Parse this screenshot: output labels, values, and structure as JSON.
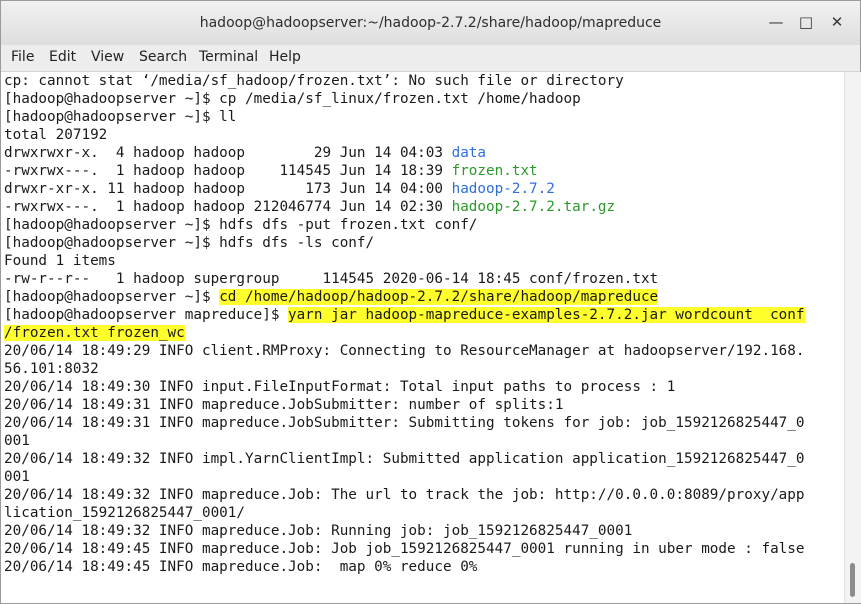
{
  "window": {
    "title": "hadoop@hadoopserver:~/hadoop-2.7.2/share/hadoop/mapreduce",
    "min_icon": "minimize-icon",
    "max_icon": "maximize-icon",
    "close_icon": "close-icon",
    "min_glyph": "—",
    "max_glyph": "□",
    "close_glyph": "✕"
  },
  "menu": [
    "File",
    "Edit",
    "View",
    "Search",
    "Terminal",
    "Help"
  ],
  "colors": {
    "highlight": "#ffff2b",
    "directory": "#2f6fd9",
    "executable": "#2a9a2a"
  },
  "lines": [
    [
      {
        "t": "cp: cannot stat ‘/media/sf_hadoop/frozen.txt’: No such file or directory"
      }
    ],
    [
      {
        "t": "[hadoop@hadoopserver ~]$ cp /media/sf_linux/frozen.txt /home/hadoop"
      }
    ],
    [
      {
        "t": "[hadoop@hadoopserver ~]$ ll"
      }
    ],
    [
      {
        "t": "total 207192"
      }
    ],
    [
      {
        "t": "drwxrwxr-x.  4 hadoop hadoop        29 Jun 14 04:03 "
      },
      {
        "t": "data",
        "c": "blue"
      }
    ],
    [
      {
        "t": "-rwxrwx---.  1 hadoop hadoop    114545 Jun 14 18:39 "
      },
      {
        "t": "frozen.txt",
        "c": "green"
      }
    ],
    [
      {
        "t": "drwxr-xr-x. 11 hadoop hadoop       173 Jun 14 04:00 "
      },
      {
        "t": "hadoop-2.7.2",
        "c": "blue"
      }
    ],
    [
      {
        "t": "-rwxrwx---.  1 hadoop hadoop 212046774 Jun 14 02:30 "
      },
      {
        "t": "hadoop-2.7.2.tar.gz",
        "c": "green"
      }
    ],
    [
      {
        "t": "[hadoop@hadoopserver ~]$ hdfs dfs -put frozen.txt conf/"
      }
    ],
    [
      {
        "t": "[hadoop@hadoopserver ~]$ hdfs dfs -ls conf/"
      }
    ],
    [
      {
        "t": "Found 1 items"
      }
    ],
    [
      {
        "t": "-rw-r--r--   1 hadoop supergroup     114545 2020-06-14 18:45 conf/frozen.txt"
      }
    ],
    [
      {
        "t": "[hadoop@hadoopserver ~]$ "
      },
      {
        "t": "cd /home/hadoop/hadoop-2.7.2/share/hadoop/mapreduce",
        "c": "hl"
      }
    ],
    [
      {
        "t": "[hadoop@hadoopserver mapreduce]$ "
      },
      {
        "t": "yarn jar hadoop-mapreduce-examples-2.7.2.jar wordcount  conf",
        "c": "hl"
      }
    ],
    [
      {
        "t": "/frozen.txt frozen_wc",
        "c": "hl"
      }
    ],
    [
      {
        "t": "20/06/14 18:49:29 INFO client.RMProxy: Connecting to ResourceManager at hadoopserver/192.168."
      }
    ],
    [
      {
        "t": "56.101:8032"
      }
    ],
    [
      {
        "t": "20/06/14 18:49:30 INFO input.FileInputFormat: Total input paths to process : 1"
      }
    ],
    [
      {
        "t": "20/06/14 18:49:31 INFO mapreduce.JobSubmitter: number of splits:1"
      }
    ],
    [
      {
        "t": "20/06/14 18:49:31 INFO mapreduce.JobSubmitter: Submitting tokens for job: job_1592126825447_0"
      }
    ],
    [
      {
        "t": "001"
      }
    ],
    [
      {
        "t": "20/06/14 18:49:32 INFO impl.YarnClientImpl: Submitted application application_1592126825447_0"
      }
    ],
    [
      {
        "t": "001"
      }
    ],
    [
      {
        "t": "20/06/14 18:49:32 INFO mapreduce.Job: The url to track the job: http://0.0.0.0:8089/proxy/app"
      }
    ],
    [
      {
        "t": "lication_1592126825447_0001/"
      }
    ],
    [
      {
        "t": "20/06/14 18:49:32 INFO mapreduce.Job: Running job: job_1592126825447_0001"
      }
    ],
    [
      {
        "t": "20/06/14 18:49:45 INFO mapreduce.Job: Job job_1592126825447_0001 running in uber mode : false"
      }
    ],
    [
      {
        "t": "20/06/14 18:49:45 INFO mapreduce.Job:  map 0% reduce 0%"
      }
    ]
  ]
}
